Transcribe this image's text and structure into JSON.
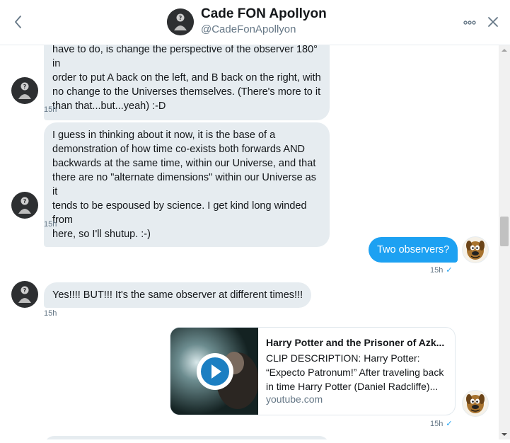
{
  "header": {
    "title": "Cade FON Apollyon",
    "handle": "@CadeFonApollyon"
  },
  "messages": [
    {
      "direction": "incoming",
      "lines": [
        "have to do, is change the perspective of the observer 180° in",
        "order to put A back on the left, and B back on the right, with",
        "no change to the Universes themselves. (There's more to it",
        "than that...but...yeah) :-D"
      ],
      "time": "15h"
    },
    {
      "direction": "incoming",
      "lines": [
        "I guess in thinking about it now, it is the base of a",
        "demonstration of how time co-exists both forwards AND",
        "backwards at the same time, within our Universe, and that",
        "there are no \"alternate dimensions\" within our Universe as it",
        "tends to be espoused by science. I get kind long winded from",
        "here, so I'll shutup. :-)"
      ],
      "time": "15h"
    },
    {
      "direction": "outgoing",
      "text": "Two observers?",
      "time": "15h",
      "status": "✓"
    },
    {
      "direction": "incoming",
      "text": "Yes!!!! BUT!!! It's the same observer at different times!!!",
      "time": "15h"
    },
    {
      "direction": "outgoing",
      "card": {
        "title": "Harry Potter and the Prisoner of Azk...",
        "description_lines": [
          "CLIP DESCRIPTION: Harry Potter:",
          "“Expecto Patronum!” After traveling back",
          "in time Harry Potter (Daniel Radcliffe)..."
        ],
        "domain": "youtube.com"
      },
      "time": "15h",
      "status": "✓"
    }
  ],
  "icons": {
    "back": "chevron-left-icon",
    "more": "more-icon",
    "close": "close-icon",
    "play": "play-icon"
  },
  "colors": {
    "accent": "#1da1f2",
    "incoming_bubble": "#e6ecf0",
    "secondary_text": "#657786"
  }
}
